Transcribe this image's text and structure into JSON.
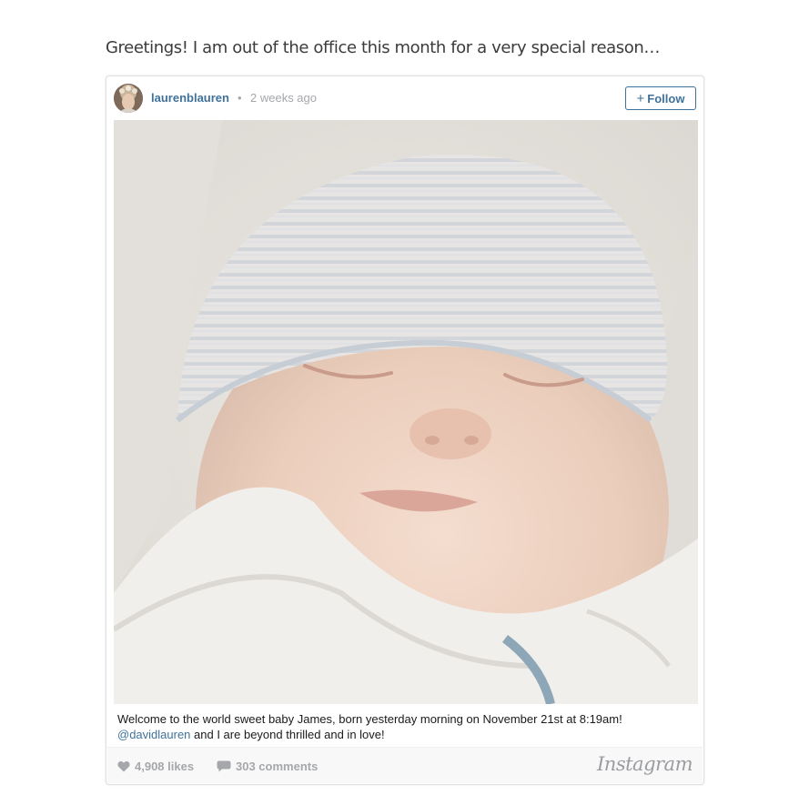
{
  "intro_text": "Greetings! I am out of the office this month for a very special reason…",
  "post": {
    "username": "laurenblauren",
    "separator": "•",
    "timestamp": "2 weeks ago",
    "follow_label": "Follow",
    "caption_main": "Welcome to the world sweet baby James, born yesterday morning on November 21st at 8:19am!",
    "caption_mention": "@davidlauren",
    "caption_rest": " and I are beyond thrilled and in love!",
    "likes": "4,908 likes",
    "comments": "303 comments",
    "brand": "Instagram"
  },
  "colors": {
    "link": "#3f729b",
    "muted": "#a5a7aa",
    "footer_bg": "#f8f8f8"
  },
  "icons": {
    "likes": "heart-icon",
    "comments": "comment-bubble-icon",
    "follow": "plus-icon"
  }
}
